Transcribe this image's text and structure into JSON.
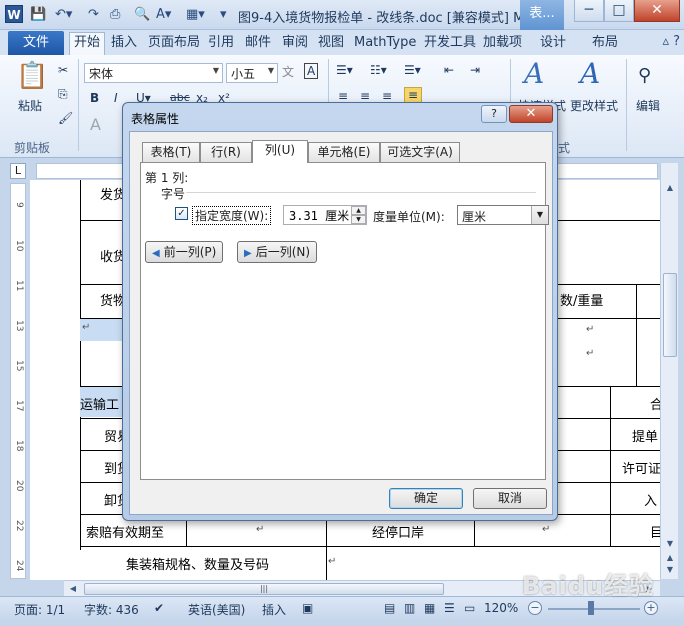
{
  "window": {
    "title": "图9-4入境货物报检单 - 改线条.doc [兼容模式] M...",
    "context_tab_head": "表...",
    "app_icon": "W",
    "controls": {
      "minimize": "─",
      "maximize": "□",
      "close": "✕"
    }
  },
  "ribbon_tabs": {
    "file": "文件",
    "items": [
      "开始",
      "插入",
      "页面布局",
      "引用",
      "邮件",
      "审阅",
      "视图",
      "MathType",
      "开发工具",
      "加载项",
      "设计",
      "布局"
    ],
    "active": "开始"
  },
  "ribbon": {
    "paste_label": "粘贴",
    "clipboard_group": "剪贴板",
    "font_name": "宋体",
    "font_size": "小五",
    "quick_style_label": "快速样式",
    "change_style_label": "更改样式",
    "edit_label": "编辑",
    "style_group_tail": "式"
  },
  "document": {
    "texts": [
      "发货",
      "收货",
      "货物",
      "数/重量",
      "运输工",
      "合",
      "贸易",
      "提单",
      "到货",
      "许可证",
      "卸货",
      "入",
      "索赔有效期至",
      "经停口岸",
      "目",
      "集装箱规格、数量及号码"
    ]
  },
  "dialog": {
    "title": "表格属性",
    "help": "?",
    "close": "✕",
    "tabs": [
      "表格(T)",
      "行(R)",
      "列(U)",
      "单元格(E)",
      "可选文字(A)"
    ],
    "active_tab": "列(U)",
    "column_label": "第 1 列:",
    "size_group": "字号",
    "checkbox_checked": true,
    "checkbox_label": "指定宽度(W):",
    "width_value": "3.31 厘米",
    "unit_label": "度量单位(M):",
    "unit_value": "厘米",
    "prev_button": "前一列(P)",
    "next_button": "后一列(N)",
    "ok_button": "确定",
    "cancel_button": "取消"
  },
  "status_bar": {
    "page": "页面: 1/1",
    "words": "字数: 436",
    "language": "英语(美国)",
    "mode": "插入",
    "zoom": "120%"
  },
  "watermark": "Baidu经验"
}
